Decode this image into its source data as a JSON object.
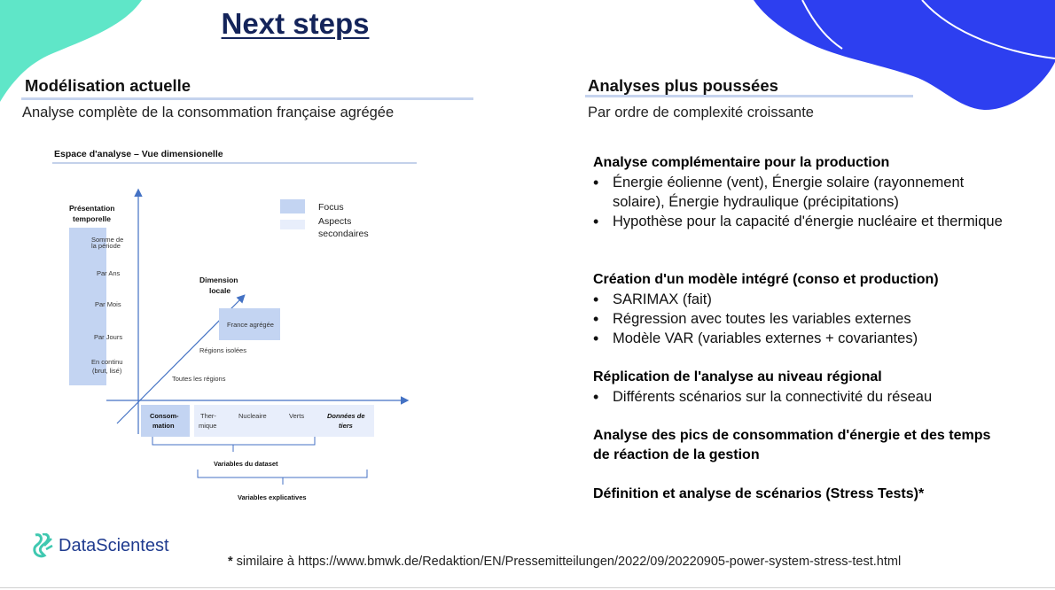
{
  "title": "Next steps",
  "left": {
    "heading": "Modélisation actuelle",
    "subtitle": "Analyse complète de la consommation française agrégée",
    "figure": {
      "title": "Espace d'analyse – Vue dimensionelle",
      "legend": {
        "focus": "Focus",
        "secondary_1": "Aspects",
        "secondary_2": "secondaires"
      },
      "time_axis_title_1": "Présentation",
      "time_axis_title_2": "temporelle",
      "time_items": [
        [
          "Somme de",
          "la période"
        ],
        [
          "Par Ans"
        ],
        [
          "Par Mois"
        ],
        [
          "Par Jours"
        ],
        [
          "En continu",
          "(brut, lisé)"
        ]
      ],
      "local_title_1": "Dimension",
      "local_title_2": "locale",
      "local_focus": "France agrégée",
      "local_items": [
        "Régions isolées",
        "Toutes les régions"
      ],
      "var_focus_1": "Consom-",
      "var_focus_2": "mation",
      "var_thermique_1": "Ther-",
      "var_thermique_2": "mique",
      "var_nucleaire": "Nucleaire",
      "var_verts": "Verts",
      "var_tiers_1": "Données de",
      "var_tiers_2": "tiers",
      "brace_dataset": "Variables du dataset",
      "brace_explicatives": "Variables explicatives"
    }
  },
  "right": {
    "heading": "Analyses plus poussées",
    "subtitle": "Par ordre de complexité croissante",
    "blocks": [
      {
        "title": "Analyse complémentaire pour la production",
        "bullets": [
          "Énergie éolienne (vent), Énergie solaire (rayonnement solaire), Énergie hydraulique (précipitations)",
          "Hypothèse pour la capacité d'énergie nucléaire et thermique"
        ]
      },
      {
        "title": "Création d'un modèle intégré (conso et production)",
        "bullets": [
          "SARIMAX (fait)",
          "Régression avec toutes les variables externes",
          "Modèle VAR (variables externes + covariantes)"
        ]
      },
      {
        "title": "Réplication de l'analyse au niveau régional",
        "bullets": [
          "Différents scénarios sur la connectivité du réseau"
        ]
      },
      {
        "title": "Analyse des pics de consommation d'énergie et des temps de réaction de la gestion",
        "bullets": []
      },
      {
        "title": "Définition et analyse de scénarios (Stress Tests)*",
        "bullets": []
      }
    ]
  },
  "brand": "DataScientest",
  "footnote": {
    "star": "*",
    "text": " similaire à https://www.bmwk.de/Redaktion/EN/Pressemitteilungen/2022/09/20220905-power-system-stress-test.html"
  },
  "colors": {
    "title": "#14245a",
    "mint_corner": "#5fe6c8",
    "blue_corner": "#2d3ff0",
    "focus_fill": "#c3d4f2",
    "secondary_fill": "#e8eefb",
    "brand_icon": "#3fc8b0"
  }
}
